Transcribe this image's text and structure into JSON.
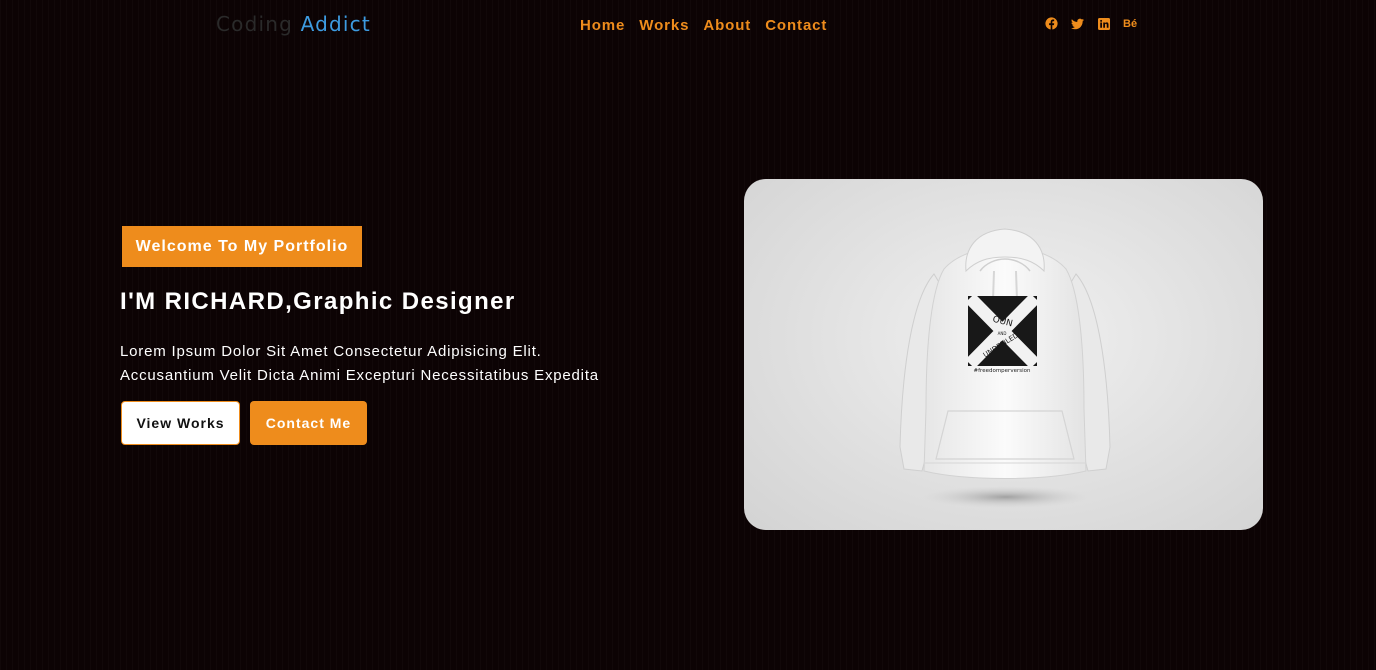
{
  "nav": {
    "logo_part1": "Coding",
    "logo_part2": "Addict",
    "menu": [
      "Home",
      "Works",
      "About",
      "Contact"
    ],
    "social_icons": [
      "facebook-icon",
      "twitter-icon",
      "linkedin-icon",
      "behance-icon"
    ],
    "behance_text": "Bé"
  },
  "hero": {
    "badge": "Welcome To My Portfolio",
    "headline": "I'M RICHARD,Graphic Designer",
    "desc_line1": "Lorem Ipsum Dolor Sit Amet Consectetur Adipisicing Elit.",
    "desc_line2": "Accusantium Velit Dicta Animi Excepturi Necessitatibus Expedita",
    "btn_works": "View Works",
    "btn_contact": "Contact Me",
    "image": {
      "subject": "white hoodie mockup",
      "print_top": "OUN",
      "print_mid": "AND",
      "print_bottom": "UNDEFILED",
      "print_tag": "#freedomperversion"
    }
  },
  "colors": {
    "background": "#0c0304",
    "accent": "#ee8c1c",
    "logo_dim": "#2a2a2a",
    "logo_blue": "#3d9be0"
  }
}
